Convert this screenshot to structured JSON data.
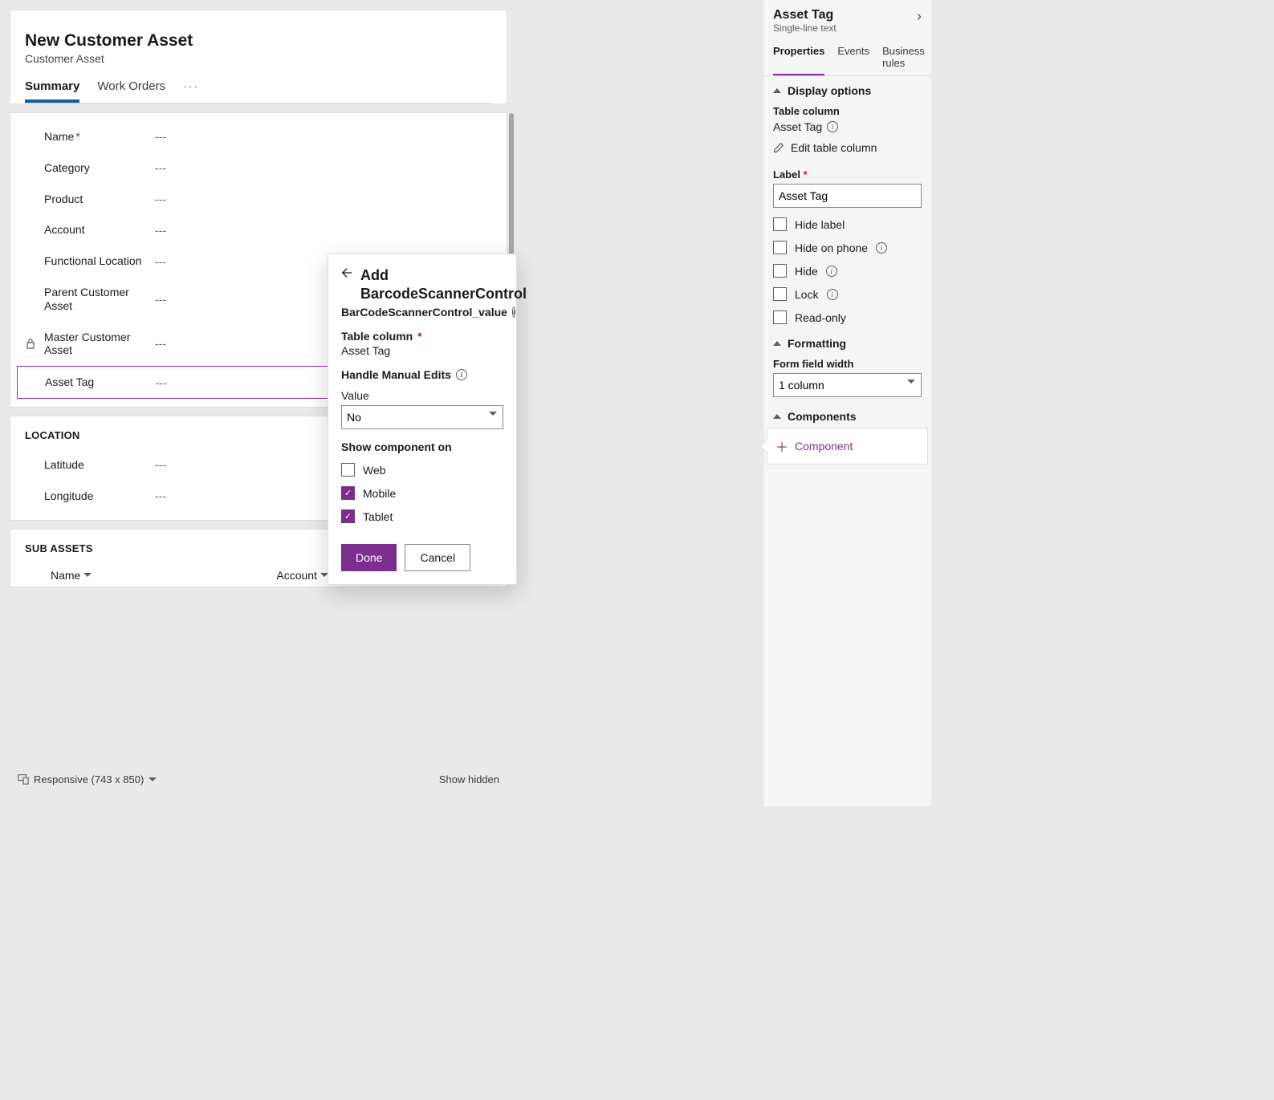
{
  "form": {
    "title": "New Customer Asset",
    "entity": "Customer Asset",
    "tabs": [
      {
        "label": "Summary",
        "active": true
      },
      {
        "label": "Work Orders",
        "active": false
      }
    ],
    "empty": "---",
    "fields": [
      {
        "label": "Name",
        "required": true
      },
      {
        "label": "Category"
      },
      {
        "label": "Product"
      },
      {
        "label": "Account"
      },
      {
        "label": "Functional Location"
      },
      {
        "label": "Parent Customer Asset"
      },
      {
        "label": "Master Customer Asset",
        "locked": true
      },
      {
        "label": "Asset Tag",
        "selected": true
      }
    ],
    "location_section": {
      "header": "LOCATION",
      "fields": [
        {
          "label": "Latitude"
        },
        {
          "label": "Longitude"
        }
      ]
    },
    "subassets": {
      "header": "SUB ASSETS",
      "columns": [
        "Name",
        "Account"
      ]
    }
  },
  "footer": {
    "mode": "Responsive (743 x 850)",
    "show_hidden": "Show hidden"
  },
  "popover": {
    "title_line1": "Add",
    "title_line2": "BarcodeScannerControl",
    "subname": "BarCodeScannerControl_value",
    "table_column_label": "Table column",
    "table_column_value": "Asset Tag",
    "manual_label": "Handle Manual Edits",
    "value_label": "Value",
    "value_selected": "No",
    "show_on_label": "Show component on",
    "web": "Web",
    "mobile": "Mobile",
    "tablet": "Tablet",
    "done": "Done",
    "cancel": "Cancel"
  },
  "rightpane": {
    "title": "Asset Tag",
    "subtitle": "Single-line text",
    "tabs": [
      "Properties",
      "Events",
      "Business rules"
    ],
    "display_options": {
      "header": "Display options",
      "table_column_label": "Table column",
      "table_column_value": "Asset Tag",
      "edit_link": "Edit table column",
      "label_label": "Label",
      "label_value": "Asset Tag",
      "hide_label": "Hide label",
      "hide_on_phone": "Hide on phone",
      "hide": "Hide",
      "lock": "Lock",
      "read_only": "Read-only"
    },
    "formatting": {
      "header": "Formatting",
      "width_label": "Form field width",
      "width_value": "1 column"
    },
    "components": {
      "header": "Components",
      "add_label": "Component"
    }
  }
}
